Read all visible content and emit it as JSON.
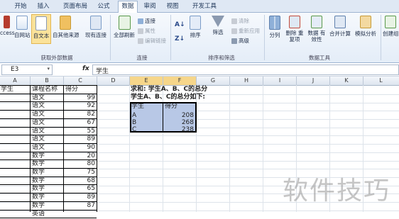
{
  "tabs": [
    "开始",
    "插入",
    "页面布局",
    "公式",
    "数据",
    "审阅",
    "视图",
    "开发工具"
  ],
  "active_tab": "数据",
  "ribbon": {
    "get_external": {
      "access": "ccess",
      "web": "自网站",
      "text": "自文本",
      "other": "自其他来源",
      "existing": "现有连接",
      "group": "获取外部数据"
    },
    "connections": {
      "refresh": "全部刷新",
      "conn": "连接",
      "props": "属性",
      "edit": "编辑链接",
      "group": "连接"
    },
    "sort": {
      "sort": "排序",
      "filter": "筛选",
      "clear": "清除",
      "reapply": "重新应用",
      "advanced": "高级",
      "group": "排序和筛选"
    },
    "tools": {
      "split": "分列",
      "remove_dup": "删除 重复项",
      "validation": "数据 有效性",
      "consolidate": "合并计算",
      "whatif": "模拟分析",
      "group": "数据工具"
    },
    "outline": {
      "create": "创建组"
    }
  },
  "formula_bar": {
    "name_box": "E3",
    "fx": "fx",
    "value": "学生"
  },
  "columns": [
    "A",
    "B",
    "C",
    "D",
    "E",
    "F",
    "G",
    "H",
    "I",
    "J",
    "K",
    "L"
  ],
  "left_table": {
    "headers": [
      "学生",
      "课程名称",
      "得分"
    ],
    "rows": [
      [
        "",
        "语文",
        "99"
      ],
      [
        "",
        "语文",
        "92"
      ],
      [
        "",
        "语文",
        "82"
      ],
      [
        "",
        "语文",
        "67"
      ],
      [
        "",
        "语文",
        "55"
      ],
      [
        "",
        "语文",
        "89"
      ],
      [
        "",
        "语文",
        "90"
      ],
      [
        "",
        "数学",
        "20"
      ],
      [
        "",
        "数学",
        "80"
      ],
      [
        "",
        "数学",
        "75"
      ],
      [
        "",
        "数学",
        "68"
      ],
      [
        "",
        "数学",
        "65"
      ],
      [
        "",
        "数学",
        "89"
      ],
      [
        "",
        "数学",
        "87"
      ],
      [
        "",
        "英语",
        ""
      ]
    ]
  },
  "notes": {
    "line1": "求和: 学生A、B、C的总分",
    "line2": "学生A、B、C的总分如下:"
  },
  "result_table": {
    "headers": [
      "学生",
      "得分"
    ],
    "rows": [
      [
        "A",
        "208"
      ],
      [
        "B",
        "268"
      ],
      [
        "C",
        "238"
      ]
    ]
  },
  "watermark": "软件技巧"
}
